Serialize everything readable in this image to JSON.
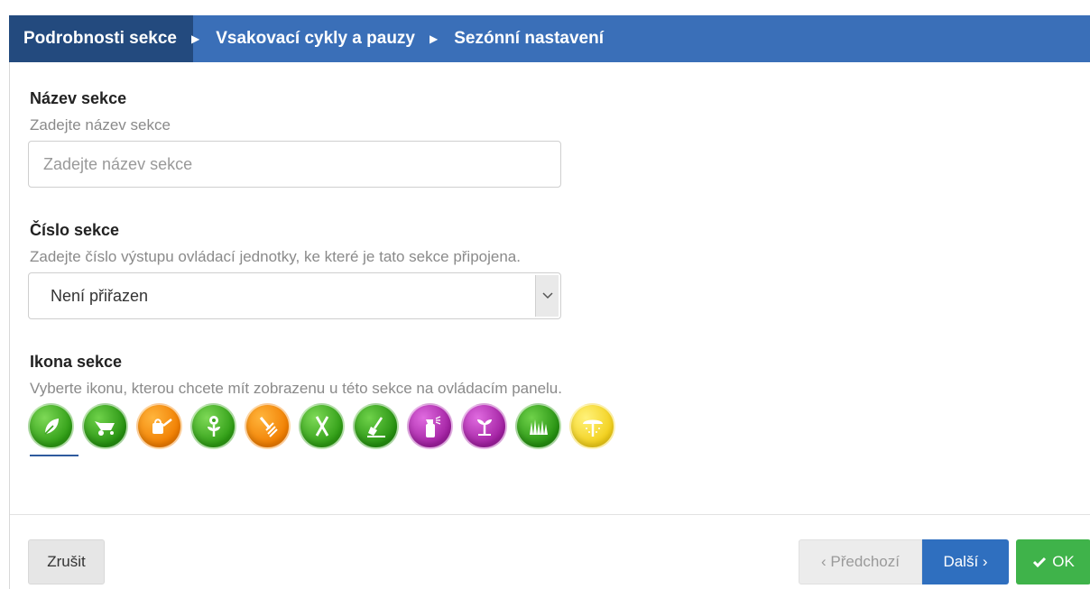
{
  "wizard": {
    "steps": [
      {
        "label": "Podrobnosti sekce"
      },
      {
        "label": "Vsakovací cykly a pauzy"
      },
      {
        "label": "Sezónní nastavení"
      }
    ]
  },
  "form": {
    "name": {
      "label": "Název sekce",
      "help": "Zadejte název sekce",
      "placeholder": "Zadejte název sekce",
      "value": ""
    },
    "number": {
      "label": "Číslo sekce",
      "help": "Zadejte číslo výstupu ovládací jednotky, ke které je tato sekce připojena.",
      "selected": "Není přiřazen"
    },
    "icon": {
      "label": "Ikona sekce",
      "help": "Vyberte ikonu, kterou chcete mít zobrazenu u této sekce na ovládacím panelu.",
      "options": [
        "leaf",
        "wheelbarrow",
        "watering-can",
        "flower",
        "rake",
        "shears",
        "shovel",
        "spray-bottle",
        "sprout",
        "grass",
        "sprinkler"
      ],
      "selected": "leaf"
    }
  },
  "footer": {
    "cancel_label": "Zrušit",
    "prev_label": "‹ Předchozí",
    "next_label": "Další ›",
    "ok_label": "OK"
  },
  "colors": {
    "nav_bg": "#3a6fb8",
    "nav_active_bg": "#234a7e",
    "next_button": "#2f6fbf",
    "ok_button": "#3fb34a"
  }
}
